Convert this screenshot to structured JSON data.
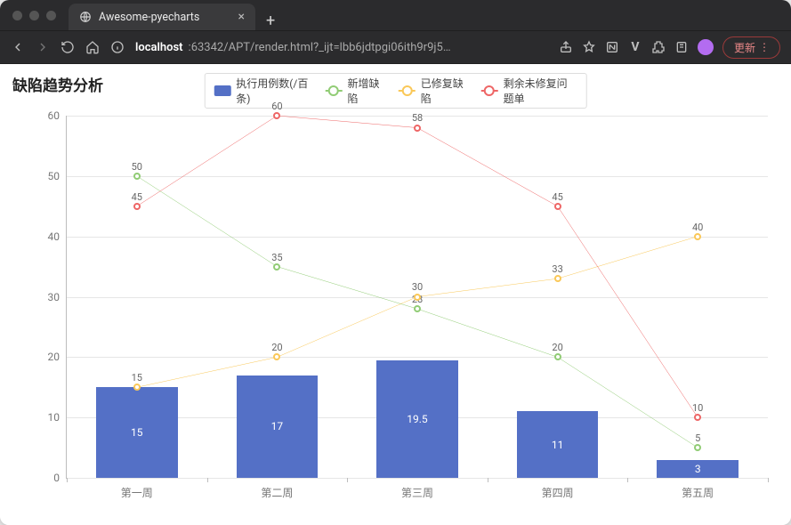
{
  "browser": {
    "tab_title": "Awesome-pyecharts",
    "url_host": "localhost",
    "url_rest": ":63342/APT/render.html?_ijt=lbb6jdtpgi06ith9r9j5…",
    "update_label": "更新"
  },
  "chart_data": {
    "type": "bar+line",
    "title": "缺陷趋势分析",
    "categories": [
      "第一周",
      "第二周",
      "第三周",
      "第四周",
      "第五周"
    ],
    "bar": {
      "name": "执行用例数(/百条)",
      "values": [
        15,
        17,
        19.5,
        11,
        3
      ]
    },
    "series": [
      {
        "name": "新增缺陷",
        "color": "#91cc75",
        "values": [
          50,
          35,
          28,
          20,
          5
        ]
      },
      {
        "name": "已修复缺陷",
        "color": "#fac858",
        "values": [
          15,
          20,
          30,
          33,
          40
        ]
      },
      {
        "name": "剩余未修复问题单",
        "color": "#ee6666",
        "values": [
          45,
          60,
          58,
          45,
          10
        ]
      }
    ],
    "ylim": [
      0,
      60
    ],
    "yticks": [
      0,
      10,
      20,
      30,
      40,
      50,
      60
    ],
    "xlabel": "",
    "ylabel": ""
  },
  "legend": {
    "bar": "执行用例数(/百条)",
    "l1": "新增缺陷",
    "l2": "已修复缺陷",
    "l3": "剩余未修复问题单"
  }
}
